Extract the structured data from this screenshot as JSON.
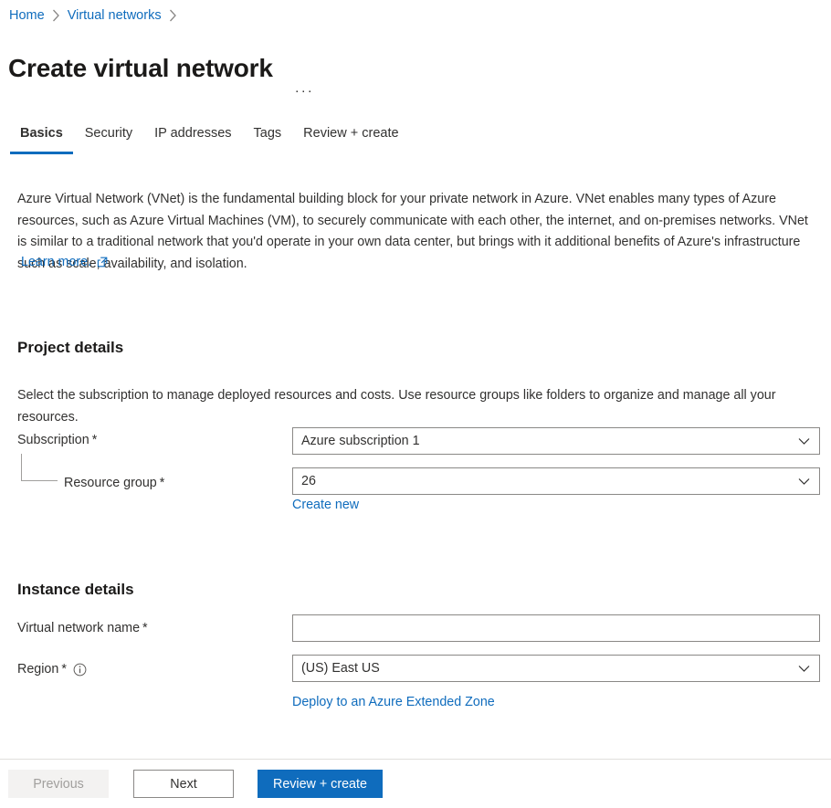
{
  "breadcrumb": {
    "items": [
      {
        "label": "Home",
        "type": "link"
      },
      {
        "label": "Virtual networks",
        "type": "link"
      }
    ],
    "separator_icon": "chevron-right-icon"
  },
  "header": {
    "title": "Create virtual network",
    "more_actions": "···"
  },
  "tabs": [
    {
      "label": "Basics",
      "active": true
    },
    {
      "label": "Security",
      "active": false
    },
    {
      "label": "IP addresses",
      "active": false
    },
    {
      "label": "Tags",
      "active": false
    },
    {
      "label": "Review + create",
      "active": false
    }
  ],
  "description": {
    "body": "Azure Virtual Network (VNet) is the fundamental building block for your private network in Azure. VNet enables many types of Azure resources, such as Azure Virtual Machines (VM), to securely communicate with each other, the internet, and on-premises networks. VNet is similar to a traditional network that you'd operate in your own data center, but brings with it additional benefits of Azure's infrastructure such as scale, availability, and isolation.",
    "learn_more_label": "Learn more.",
    "learn_more_icon": "external-link-icon"
  },
  "project_details": {
    "heading": "Project details",
    "description": "Select the subscription to manage deployed resources and costs. Use resource groups like folders to organize and manage all your resources.",
    "subscription": {
      "label": "Subscription",
      "required_marker": "*",
      "value": "Azure subscription 1",
      "chevron_icon": "chevron-down-icon"
    },
    "resource_group": {
      "label": "Resource group",
      "required_marker": "*",
      "value": "26",
      "chevron_icon": "chevron-down-icon",
      "create_new_label": "Create new"
    }
  },
  "instance_details": {
    "heading": "Instance details",
    "virtual_network_name": {
      "label": "Virtual network name",
      "required_marker": "*",
      "value": "",
      "placeholder": ""
    },
    "region": {
      "label": "Region",
      "required_marker": "*",
      "info_icon": "info-icon",
      "value": "(US) East US",
      "chevron_icon": "chevron-down-icon",
      "extended_zone_label": "Deploy to an Azure Extended Zone"
    }
  },
  "footer": {
    "previous_label": "Previous",
    "next_label": "Next",
    "review_create_label": "Review + create"
  },
  "colors": {
    "accent": "#0f6cbd",
    "link": "#0f6cbd",
    "text": "#323130",
    "heading": "#1b1a19",
    "border": "#8a8886",
    "disabled_bg": "#f3f2f1",
    "disabled_text": "#a19f9d"
  }
}
